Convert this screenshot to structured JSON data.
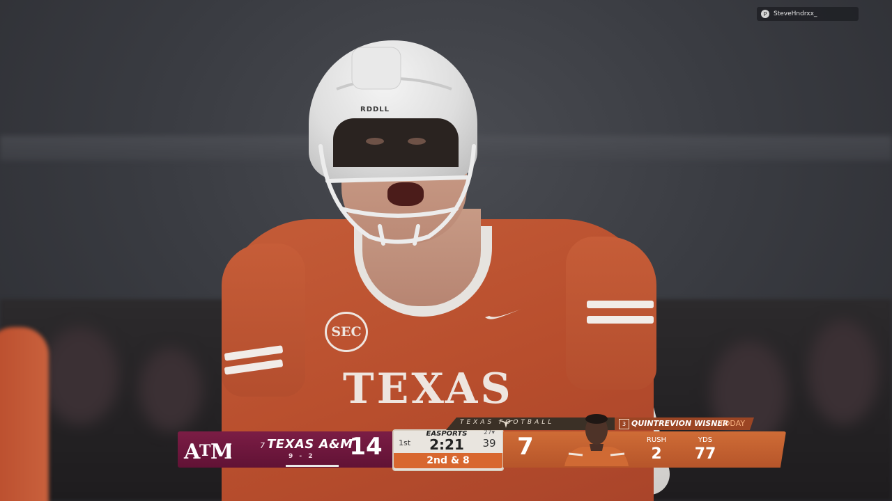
{
  "overlay": {
    "psn_user": "SteveHndrxx_",
    "psn_icon": "playstation-icon"
  },
  "jersey": {
    "text": "TEXAS",
    "patch": "SEC",
    "helmet_brand": "RDDLL"
  },
  "scorebug": {
    "away": {
      "logo_text": "ĀM",
      "rank": "7",
      "name": "TEXAS A&M",
      "record": "9 - 2",
      "score": "14",
      "color": "#6b1739"
    },
    "clock": {
      "quarter": "1st",
      "sponsor": "EASPORTS",
      "game_clock": "2:21",
      "timeouts": "27▾",
      "play_clock": "39",
      "down_distance": "2nd & 8"
    },
    "home": {
      "brand": "TEXAS FOOTBALL",
      "score": "7",
      "color": "#c86330"
    },
    "player": {
      "number": "3",
      "name": "QUINTREVION WISNER",
      "today": "TODAY",
      "stats": [
        {
          "label": "RUSH",
          "value": "2"
        },
        {
          "label": "YDS",
          "value": "77"
        }
      ]
    }
  }
}
